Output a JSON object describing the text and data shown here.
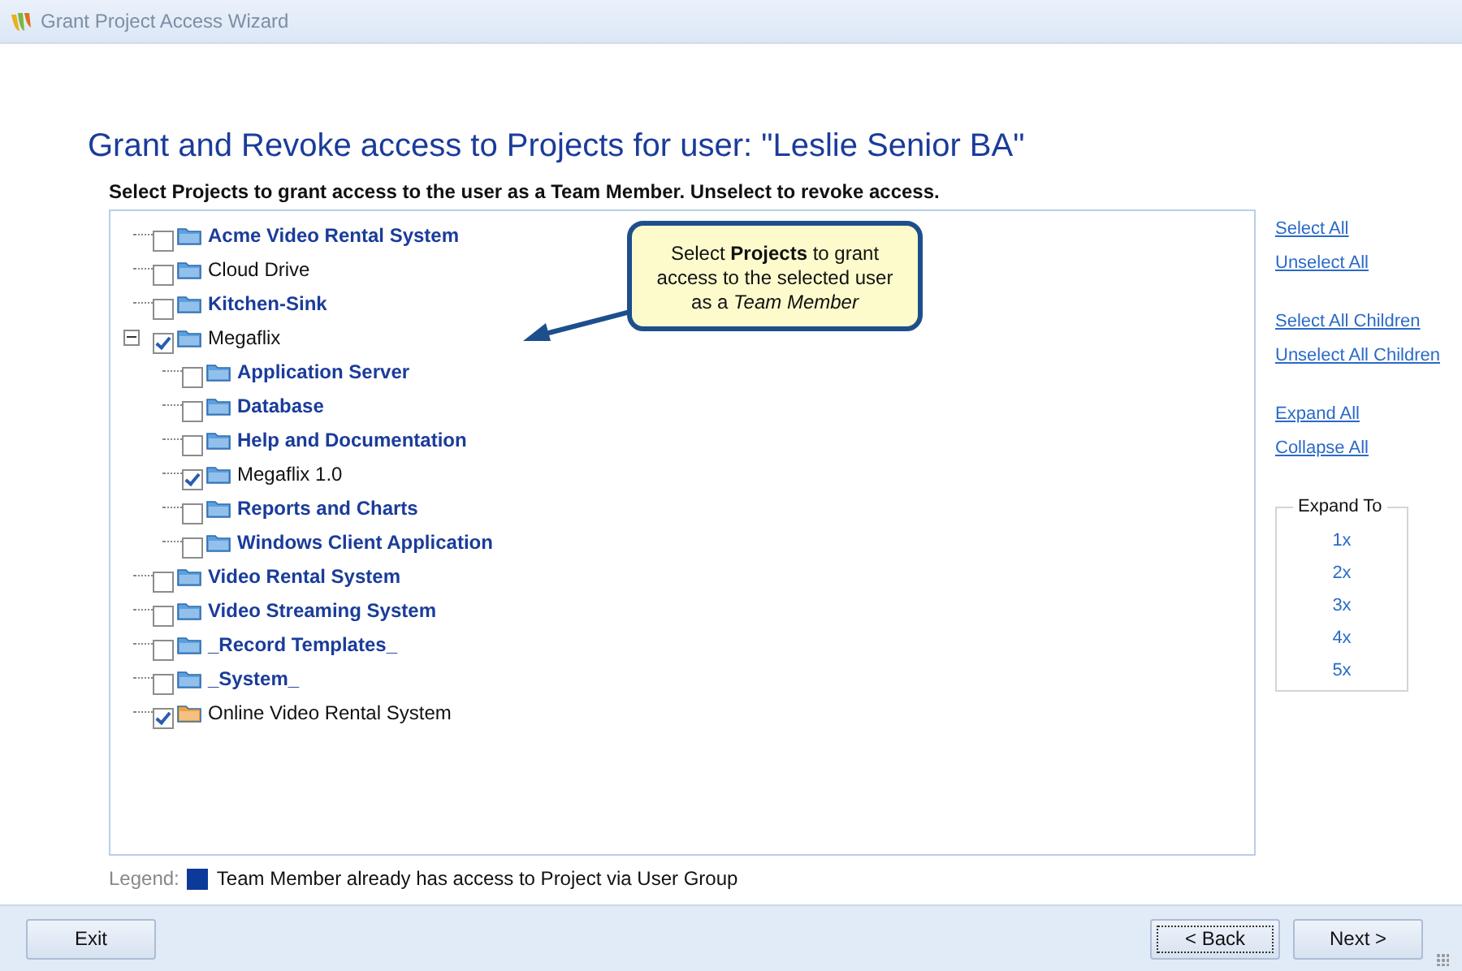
{
  "window": {
    "title": "Grant Project Access Wizard"
  },
  "heading": "Grant and Revoke access to Projects for user: \"Leslie Senior BA\"",
  "instruction": "Select Projects to grant access to the user as a Team Member. Unselect to revoke access.",
  "tree": [
    {
      "label": "Acme Video Rental System",
      "checked": false,
      "group_access": true,
      "color": "#5a9fe0"
    },
    {
      "label": "Cloud Drive",
      "checked": false,
      "group_access": false,
      "color": "#5a9fe0"
    },
    {
      "label": "Kitchen-Sink",
      "checked": false,
      "group_access": true,
      "color": "#5a9fe0"
    },
    {
      "label": "Megaflix",
      "checked": true,
      "group_access": false,
      "color": "#5a9fe0",
      "expanded": true,
      "children": [
        {
          "label": "Application Server",
          "checked": false,
          "group_access": true,
          "color": "#5a9fe0"
        },
        {
          "label": "Database",
          "checked": false,
          "group_access": true,
          "color": "#5a9fe0"
        },
        {
          "label": "Help and Documentation",
          "checked": false,
          "group_access": true,
          "color": "#5a9fe0"
        },
        {
          "label": "Megaflix 1.0",
          "checked": true,
          "group_access": false,
          "color": "#5a9fe0"
        },
        {
          "label": "Reports and Charts",
          "checked": false,
          "group_access": true,
          "color": "#5a9fe0"
        },
        {
          "label": "Windows Client Application",
          "checked": false,
          "group_access": true,
          "color": "#5a9fe0"
        }
      ]
    },
    {
      "label": "Video Rental System",
      "checked": false,
      "group_access": true,
      "color": "#5a9fe0"
    },
    {
      "label": "Video Streaming System",
      "checked": false,
      "group_access": true,
      "color": "#5a9fe0"
    },
    {
      "label": "_Record Templates_",
      "checked": false,
      "group_access": true,
      "color": "#5a9fe0"
    },
    {
      "label": "_System_",
      "checked": false,
      "group_access": true,
      "color": "#5a9fe0"
    },
    {
      "label": "Online Video Rental System",
      "checked": true,
      "group_access": false,
      "color": "#f0a040"
    }
  ],
  "callout": "Select **Projects** to grant access to the selected user as a *Team Member*",
  "link_groups": [
    [
      "Select All",
      "Unselect All"
    ],
    [
      "Select All Children",
      "Unselect All Children"
    ],
    [
      "Expand All",
      "Collapse All"
    ]
  ],
  "expand_to": {
    "title": "Expand To",
    "options": [
      "1x",
      "2x",
      "3x",
      "4x",
      "5x"
    ]
  },
  "legend": {
    "label": "Legend:",
    "text": "Team Member already has access to Project via User Group"
  },
  "buttons": {
    "exit": "Exit",
    "back": "< Back",
    "next": "Next >"
  }
}
